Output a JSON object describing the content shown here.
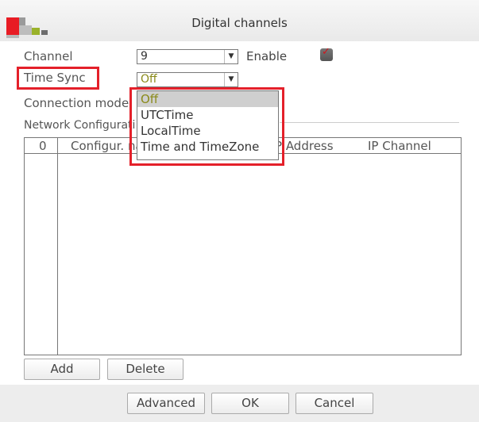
{
  "window": {
    "title": "Digital channels"
  },
  "form": {
    "channel_label": "Channel",
    "channel_value": "9",
    "enable_label": "Enable",
    "enable_checked": true,
    "time_sync_label": "Time Sync",
    "time_sync_value": "Off",
    "connection_mode_label": "Connection mode",
    "network_config_label": "Network Configurati"
  },
  "time_sync_dropdown": {
    "options": [
      "Off",
      "UTCTime",
      "LocalTime",
      "Time and TimeZone"
    ],
    "selected": "Off"
  },
  "table": {
    "columns": [
      "0",
      "Configur. na",
      "P Address",
      "IP Channel"
    ],
    "rows": []
  },
  "table_buttons": {
    "add": "Add",
    "delete": "Delete"
  },
  "footer_buttons": {
    "advanced": "Advanced",
    "ok": "OK",
    "cancel": "Cancel"
  },
  "colors": {
    "highlight": "#e4202a",
    "selected_text": "#8a8a1a",
    "checkbox_mark": "#d0151b"
  }
}
